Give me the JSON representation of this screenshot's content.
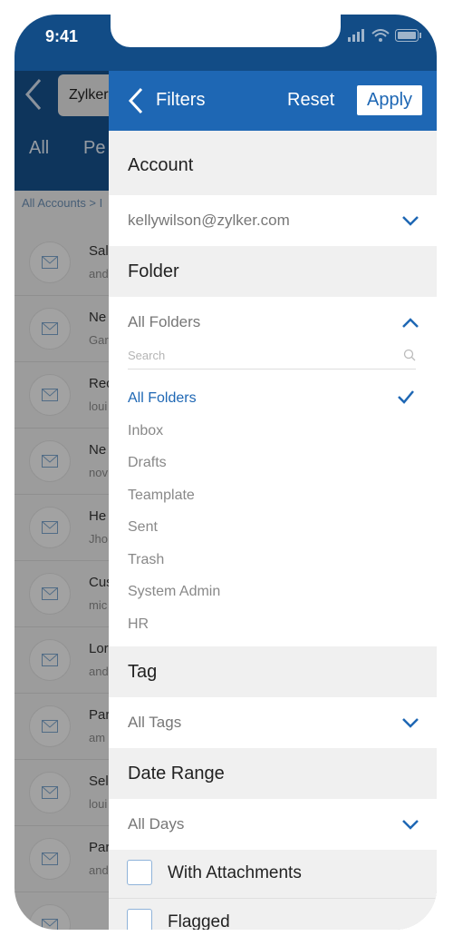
{
  "status": {
    "time": "9:41"
  },
  "background": {
    "account_chip": "Zylker",
    "tabs": [
      "All",
      "Pe"
    ],
    "breadcrumb": "All Accounts > I",
    "rows": [
      {
        "title": "Sal",
        "sub": "and"
      },
      {
        "title": "Ne",
        "sub": "Gar"
      },
      {
        "title": "Rec",
        "sub": "loui"
      },
      {
        "title": "Ne",
        "sub": "nov"
      },
      {
        "title": "He",
        "sub": "Jho"
      },
      {
        "title": "Cus",
        "sub": "mic"
      },
      {
        "title": "Lor",
        "sub": "and"
      },
      {
        "title": "Par",
        "sub": "am"
      },
      {
        "title": "Sel",
        "sub": "loui"
      },
      {
        "title": "Par",
        "sub": "and"
      },
      {
        "title": "",
        "sub": "nev"
      }
    ]
  },
  "filters": {
    "title": "Filters",
    "reset_label": "Reset",
    "apply_label": "Apply",
    "account": {
      "header": "Account",
      "value": "kellywilson@zylker.com"
    },
    "folder": {
      "header": "Folder",
      "value": "All Folders",
      "search_placeholder": "Search",
      "options": [
        "All Folders",
        "Inbox",
        "Drafts",
        "Teamplate",
        "Sent",
        "Trash",
        "System Admin",
        "HR"
      ],
      "selected": "All Folders"
    },
    "tag": {
      "header": "Tag",
      "value": "All Tags"
    },
    "date_range": {
      "header": "Date Range",
      "value": "All Days"
    },
    "checkboxes": [
      {
        "label": "With Attachments",
        "checked": false
      },
      {
        "label": "Flagged",
        "checked": false
      }
    ]
  },
  "colors": {
    "accent": "#1e67b4",
    "header_dark": "#124c86"
  }
}
